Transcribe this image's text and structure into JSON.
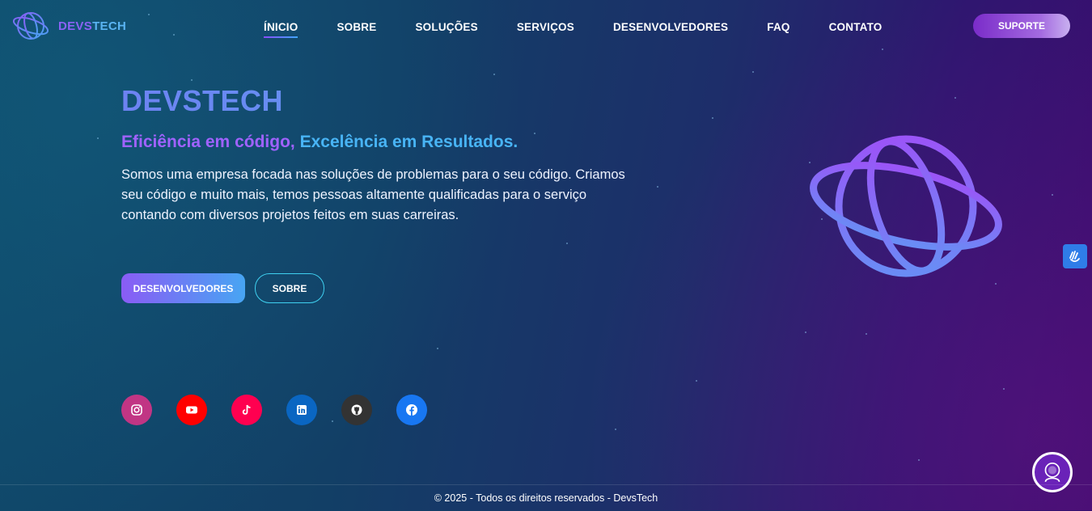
{
  "brand": {
    "part_a": "DEVS",
    "part_b": "TECH"
  },
  "nav": {
    "items": [
      "ÍNICIO",
      "SOBRE",
      "SOLUÇÕES",
      "SERVIÇOS",
      "DESENVOLVEDORES",
      "FAQ",
      "CONTATO"
    ],
    "active_index": 0
  },
  "support_label": "SUPORTE",
  "hero": {
    "title": "DEVSTECH",
    "tagline_a": "Eficiência em código,",
    "tagline_b": "Excelência em Resultados.",
    "description": "Somos uma empresa focada nas soluções de problemas para o seu código. Criamos seu código e muito mais, temos pessoas altamente qualificadas para o serviço contando com diversos projetos feitos em suas carreiras."
  },
  "cta": {
    "primary_label": "DESENVOLVEDORES",
    "secondary_label": "SOBRE"
  },
  "socials": [
    {
      "name": "instagram-icon",
      "color": "#c13584"
    },
    {
      "name": "youtube-icon",
      "color": "#ff0000"
    },
    {
      "name": "tiktok-icon",
      "color": "#ff0050"
    },
    {
      "name": "linkedin-icon",
      "color": "#0a66c2"
    },
    {
      "name": "github-icon",
      "color": "#333333"
    },
    {
      "name": "facebook-icon",
      "color": "#1877f2"
    }
  ],
  "footer": {
    "copyright": "© 2025 - Todos os direitos reservados - DevsTech"
  },
  "colors": {
    "accent_purple": "#8a5cf5",
    "accent_blue": "#47a5f3",
    "outline_cyan": "#3fd0f0"
  }
}
